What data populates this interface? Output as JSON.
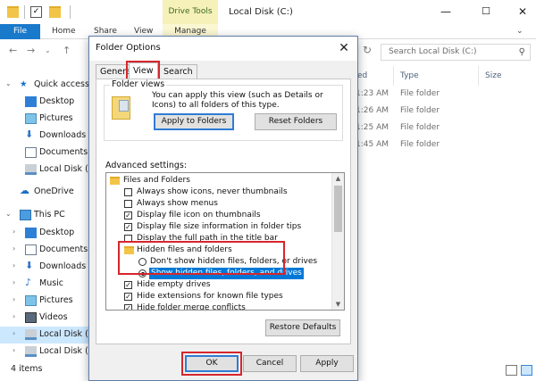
{
  "explorer": {
    "title": "Local Disk (C:)",
    "context_tab": "Drive Tools",
    "ribbon_tabs": {
      "file": "File",
      "home": "Home",
      "share": "Share",
      "view": "View",
      "manage": "Manage"
    },
    "search_placeholder": "Search Local Disk (C:)",
    "columns": {
      "modified": "ed",
      "type": "Type",
      "size": "Size"
    },
    "rows": [
      {
        "time": "1:23 AM",
        "type": "File folder"
      },
      {
        "time": "1:26 AM",
        "type": "File folder"
      },
      {
        "time": "1:25 AM",
        "type": "File folder"
      },
      {
        "time": "1:45 AM",
        "type": "File folder"
      }
    ],
    "nav": {
      "quick_access": "Quick access",
      "qa_desktop": "Desktop",
      "qa_pictures": "Pictures",
      "qa_downloads": "Downloads",
      "qa_documents": "Documents",
      "qa_local_disk": "Local Disk (C",
      "onedrive": "OneDrive",
      "this_pc": "This PC",
      "pc_desktop": "Desktop",
      "pc_documents": "Documents",
      "pc_downloads": "Downloads",
      "pc_music": "Music",
      "pc_pictures": "Pictures",
      "pc_videos": "Videos",
      "pc_local_c": "Local Disk (C",
      "pc_local_e": "Local Disk (E"
    },
    "status": {
      "items": "4 items"
    }
  },
  "dialog": {
    "title": "Folder Options",
    "tabs": {
      "general": "General",
      "view": "View",
      "search": "Search"
    },
    "folder_views": {
      "legend": "Folder views",
      "text": "You can apply this view (such as Details or Icons) to all folders of this type.",
      "apply_button": "Apply to Folders",
      "reset_button": "Reset Folders"
    },
    "advanced": {
      "label": "Advanced settings:",
      "items": {
        "files_and_folders": "Files and Folders",
        "always_icons": "Always show icons, never thumbnails",
        "always_menus": "Always show menus",
        "file_icon_thumbnails": "Display file icon on thumbnails",
        "file_size_tips": "Display file size information in folder tips",
        "full_path": "Display the full path in the title bar",
        "hidden_group": "Hidden files and folders",
        "dont_show_hidden": "Don't show hidden files, folders, or drives",
        "show_hidden": "Show hidden files, folders, and drives",
        "hide_empty": "Hide empty drives",
        "hide_extensions": "Hide extensions for known file types",
        "hide_merge": "Hide folder merge conflicts"
      },
      "restore_button": "Restore Defaults"
    },
    "buttons": {
      "ok": "OK",
      "cancel": "Cancel",
      "apply": "Apply"
    }
  },
  "colors": {
    "accent": "#0078d7",
    "annotation": "#d6262c",
    "file_tab": "#1979ca",
    "context_tab": "#f6f1b9"
  }
}
